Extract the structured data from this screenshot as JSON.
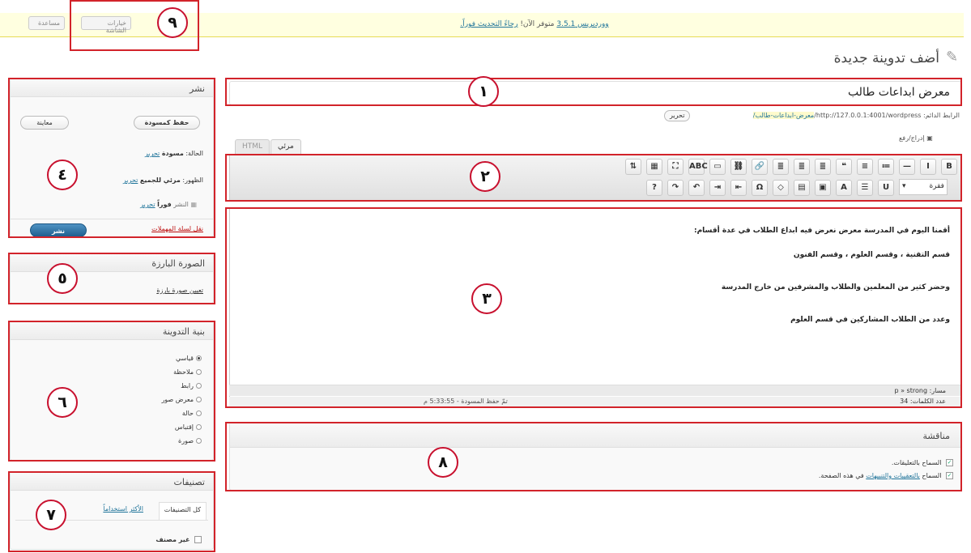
{
  "notice": {
    "version_text": "ووردبريس 3.5.1",
    "text": "متوفر الآن!",
    "link": "رجاءً التحديث فوراً."
  },
  "top_tabs": {
    "screen_options": "خيارات الشاشة",
    "help": "مساعدة"
  },
  "page": {
    "title": "أضف تدوينة جديدة"
  },
  "post": {
    "title": "معرض ابداعات طالب",
    "permalink_label": "الرابط الدائم:",
    "permalink_url": "http://127.0.0.1:4001/wordpress/",
    "permalink_slug": "معرض-ابداعات-طالب/",
    "permalink_edit": "تحرير",
    "upload_insert": "إدراج/رفع"
  },
  "editor": {
    "tab_visual": "مرئي",
    "tab_html": "HTML",
    "format_select": "فقرة",
    "toolbar_row1": [
      "B",
      "I",
      "—",
      "≔",
      "≡",
      "❝",
      "≣",
      "≣",
      "≣",
      "🔗",
      "⛓",
      "▭",
      "ABC",
      "⛶",
      "▦",
      "⇅"
    ],
    "toolbar_row2": [
      "U",
      "☰",
      "A",
      "▣",
      "▤",
      "◇",
      "Ω",
      "⇤",
      "⇥",
      "↶",
      "↷",
      "?"
    ],
    "content_lines": [
      "أقمنا اليوم في المدرسة معرض نعرض فيه ابداع الطلاب في عدة أقسام:",
      "قسم التقنية ، وقسم العلوم ، وقسم الفنون",
      "وحضر كثير من المعلمين والطلاب والمشرفين من خارج المدرسة",
      "وعدد من الطلاب المشاركين في قسم العلوم"
    ],
    "path_label": "مسار:",
    "path_value": "p » strong",
    "word_count_label": "عدد الكلمات:",
    "word_count": "34",
    "draft_saved": "تمّ حفظ المسودة - 5:33:55 م"
  },
  "discussion": {
    "title": "مناقشة",
    "allow_comments": "السماح بالتعليقات.",
    "allow_trackbacks_prefix": "السماح",
    "allow_trackbacks_link": "بالتعقيبات والتنبيهات",
    "allow_trackbacks_suffix": "في هذه الصفحة."
  },
  "publish_box": {
    "title": "نشر",
    "save_draft": "حفظ كمسودة",
    "preview": "معاينة",
    "status_label": "الحالة:",
    "status_value": "مسودة",
    "visibility_label": "الظهور:",
    "visibility_value": "مرئي للجميع",
    "publish_label": "النشر",
    "publish_value": "فوراً",
    "edit": "تحرير",
    "trash": "نقل لسلة المهملات",
    "publish": "نشر"
  },
  "featured_image": {
    "title": "الصورة البارزة",
    "set_link": "تعيين صورة بارزة"
  },
  "post_format": {
    "title": "بنية التدوينة",
    "options": [
      "قياسي",
      "ملاحظة",
      "رابط",
      "معرض صور",
      "حالة",
      "إقتباس",
      "صورة"
    ],
    "selected": "قياسي"
  },
  "categories": {
    "title": "تصنيفات",
    "tab_all": "كل التصنيفات",
    "tab_popular": "الأكثر استخداماً",
    "uncategorized": "غير مصنف"
  },
  "annotations": [
    "١",
    "٢",
    "٣",
    "٤",
    "٥",
    "٦",
    "٧",
    "٨",
    "٩"
  ]
}
